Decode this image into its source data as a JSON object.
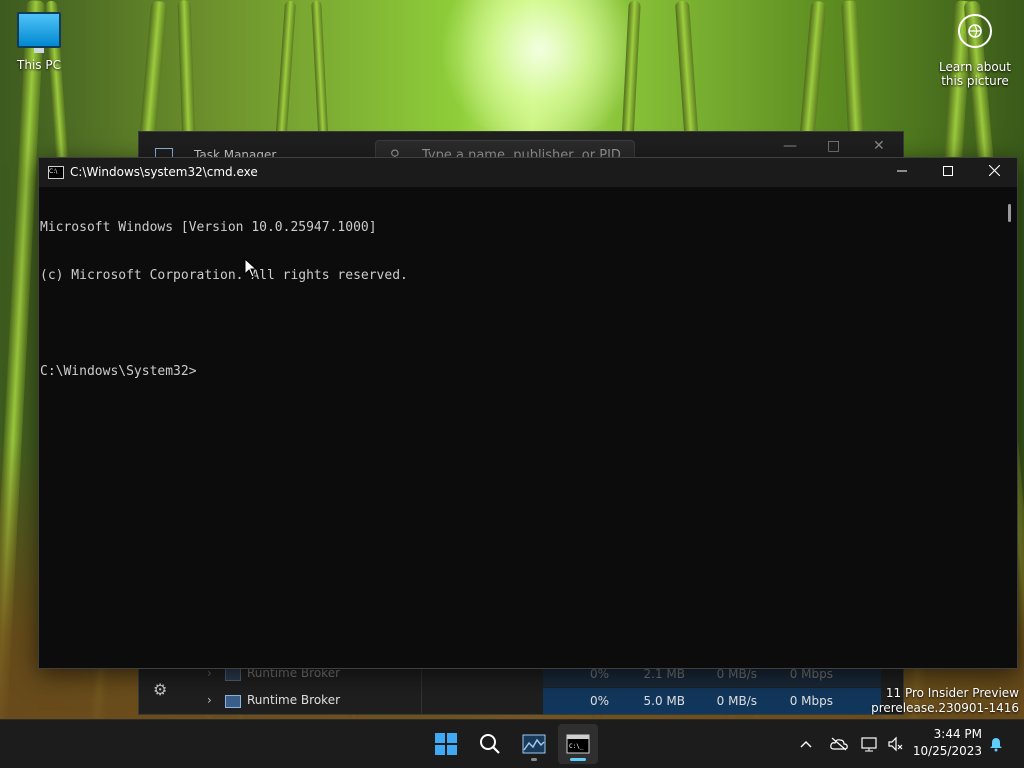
{
  "desktop": {
    "icons": [
      {
        "label": "This PC"
      },
      {
        "label": "Learn about this picture"
      }
    ],
    "watermark": {
      "line1": "11 Pro Insider Preview",
      "line2": "prerelease.230901-1416"
    }
  },
  "task_manager": {
    "title": "Task Manager",
    "search_placeholder": "Type a name, publisher, or PID",
    "rows": [
      {
        "name": "Runtime Broker",
        "cpu": "0%",
        "memory": "2.1 MB",
        "disk": "0 MB/s",
        "network": "0 Mbps"
      },
      {
        "name": "Runtime Broker",
        "cpu": "0%",
        "memory": "5.0 MB",
        "disk": "0 MB/s",
        "network": "0 Mbps"
      }
    ]
  },
  "cmd": {
    "title": "C:\\Windows\\system32\\cmd.exe",
    "lines": [
      "Microsoft Windows [Version 10.0.25947.1000]",
      "(c) Microsoft Corporation. All rights reserved.",
      "",
      "C:\\Windows\\System32>"
    ]
  },
  "taskbar": {
    "time": "3:44 PM",
    "date": "10/25/2023",
    "accent": "#60cdff"
  }
}
